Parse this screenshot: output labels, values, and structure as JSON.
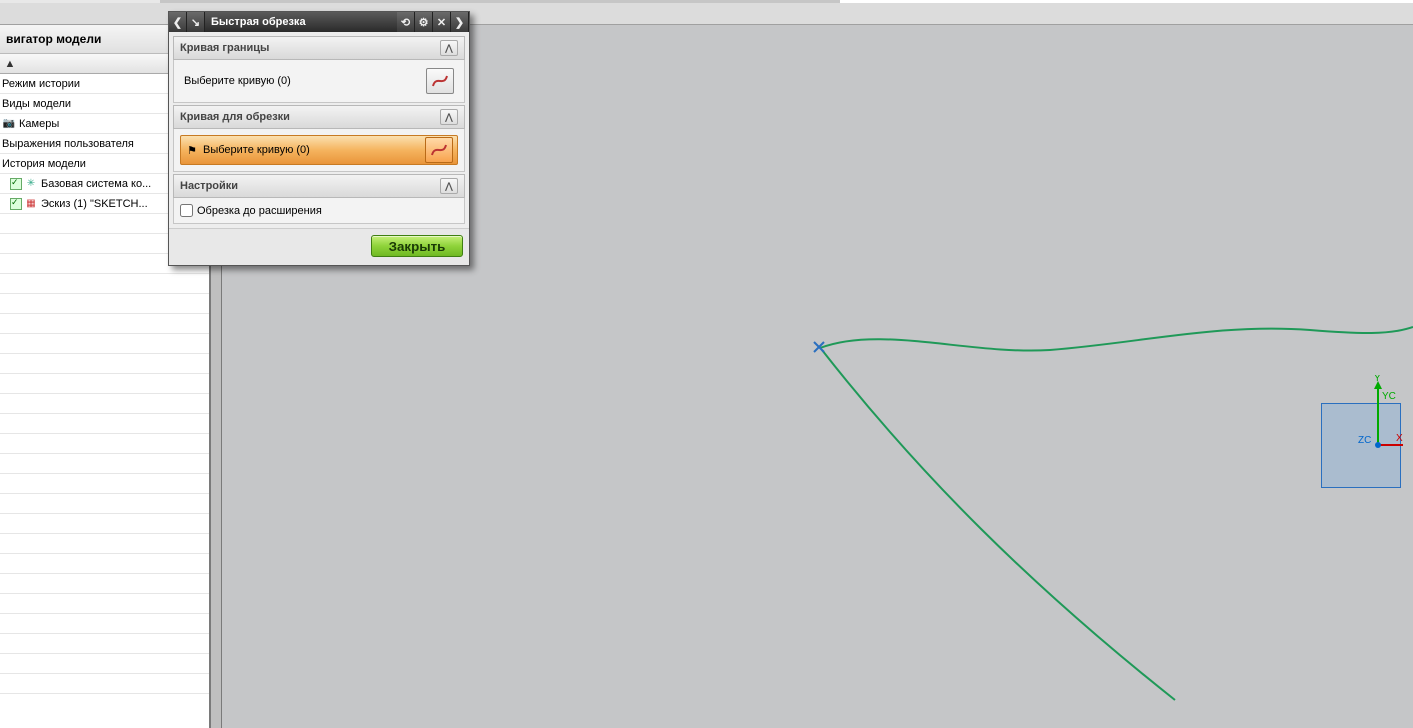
{
  "top_status_right": "",
  "sidebar": {
    "title": "вигатор модели",
    "items": [
      {
        "label": "Режим истории",
        "check": false,
        "icon": ""
      },
      {
        "label": "Виды модели",
        "check": false,
        "icon": ""
      },
      {
        "label": "Камеры",
        "check": false,
        "icon": "📷"
      },
      {
        "label": "Выражения пользователя",
        "check": false,
        "icon": ""
      },
      {
        "label": "История модели",
        "check": false,
        "icon": ""
      },
      {
        "label": "Базовая система ко...",
        "check": true,
        "icon": "✳"
      },
      {
        "label": "Эскиз (1) \"SKETCH...",
        "check": true,
        "icon": "▦"
      }
    ]
  },
  "dialog": {
    "title": "Быстрая обрезка",
    "sections": {
      "boundary": {
        "header": "Кривая границы",
        "select_label": "Выберите кривую (0)"
      },
      "trim": {
        "header": "Кривая для обрезки",
        "select_label": "Выберите кривую (0)"
      },
      "settings": {
        "header": "Настройки",
        "checkbox_label": "Обрезка до расширения"
      }
    },
    "close_label": "Закрыть"
  },
  "triad": {
    "yc": "YC",
    "zc": "ZC",
    "x": "X",
    "y": "Y"
  }
}
